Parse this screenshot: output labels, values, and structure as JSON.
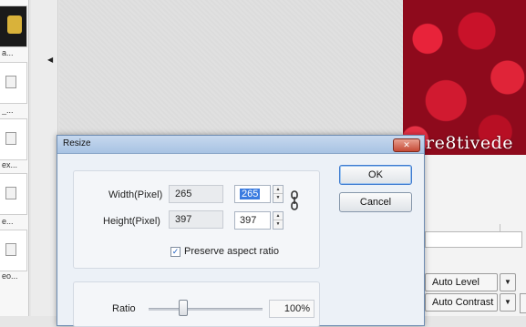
{
  "thumbnails": [
    {
      "caption": "a..."
    },
    {
      "caption": "_..."
    },
    {
      "caption": "ex..."
    },
    {
      "caption": "e..."
    },
    {
      "caption": "eo..."
    }
  ],
  "photo": {
    "watermark": "Cre8tivede"
  },
  "right_panel": {
    "auto_level_label": "Auto Level",
    "auto_contrast_label": "Auto Contrast"
  },
  "dialog": {
    "title": "Resize",
    "width_label": "Width(Pixel)",
    "width_original": "265",
    "width_value": "265",
    "height_label": "Height(Pixel)",
    "height_original": "397",
    "height_value": "397",
    "preserve_label": "Preserve aspect ratio",
    "preserve_checked": "✓",
    "ok_label": "OK",
    "cancel_label": "Cancel",
    "ratio_label": "Ratio",
    "ratio_value": "100%",
    "ratio_percent": 100
  },
  "icons": {
    "close": "close-icon",
    "chain": "chain-link-icon",
    "dropdown": "chevron-down-icon",
    "spin_up": "spin-up-icon",
    "spin_down": "spin-down-icon",
    "collapse": "collapse-arrow-icon"
  },
  "colors": {
    "accent": "#3a7be0",
    "title_bar": "#b7cde8",
    "photo_red": "#d11a30"
  }
}
